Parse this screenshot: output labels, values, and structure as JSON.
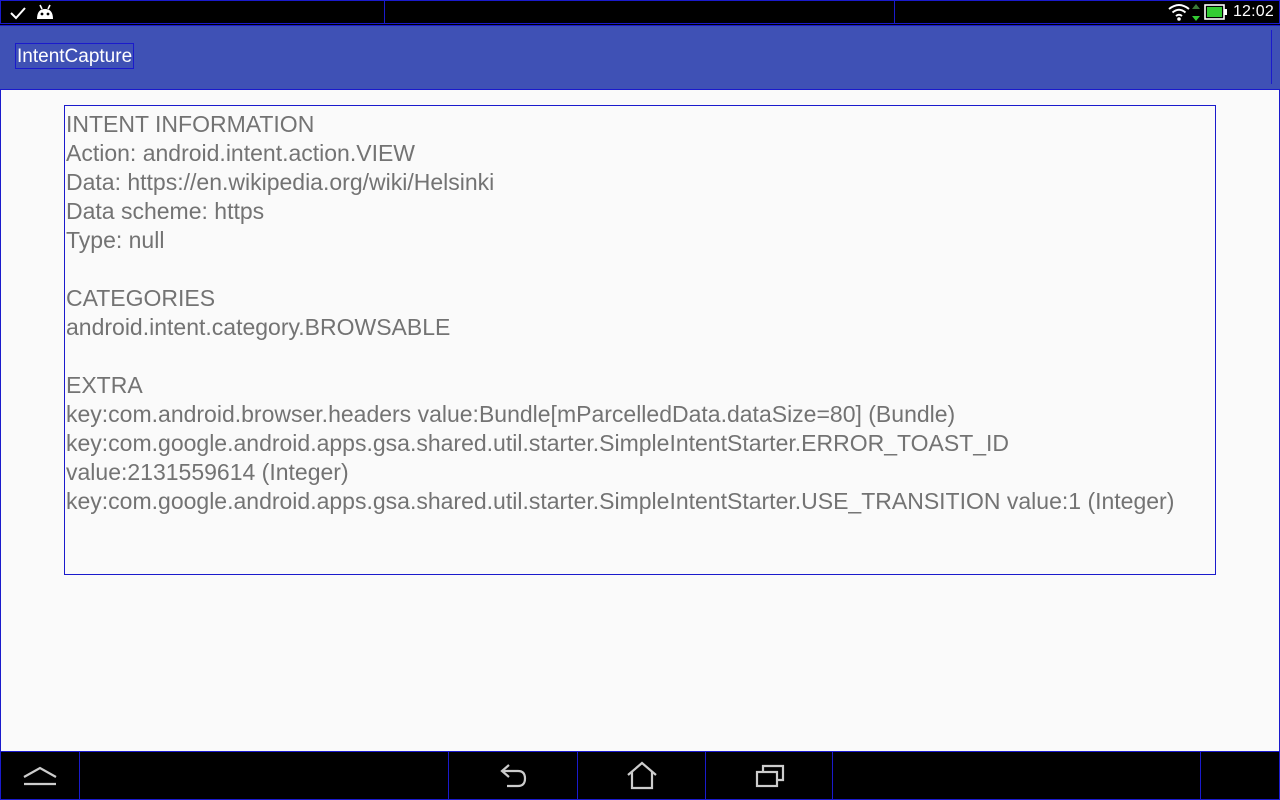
{
  "status_bar": {
    "left_icons": [
      "checkmark-icon",
      "android-debug-icon"
    ],
    "right_icons": [
      "wifi-icon",
      "data-arrows-icon",
      "battery-icon"
    ],
    "time": "12:02"
  },
  "app": {
    "title": "IntentCapture",
    "accent_color": "#3f51b5"
  },
  "intent_info": {
    "heading": "INTENT INFORMATION",
    "action": "Action: android.intent.action.VIEW",
    "data": "Data: https://en.wikipedia.org/wiki/Helsinki",
    "data_scheme": "Data scheme: https",
    "type": "Type: null"
  },
  "categories": {
    "heading": "CATEGORIES",
    "items": [
      "android.intent.category.BROWSABLE"
    ]
  },
  "extra": {
    "heading": "EXTRA",
    "items": [
      "key:com.android.browser.headers value:Bundle[mParcelledData.dataSize=80] (Bundle)",
      "key:com.google.android.apps.gsa.shared.util.starter.SimpleIntentStarter.ERROR_TOAST_ID value:2131559614 (Integer)",
      "key:com.google.android.apps.gsa.shared.util.starter.SimpleIntentStarter.USE_TRANSITION value:1 (Integer)"
    ]
  },
  "nav_bar": {
    "buttons": [
      "collapse-icon",
      "back-icon",
      "home-icon",
      "recents-icon"
    ]
  }
}
